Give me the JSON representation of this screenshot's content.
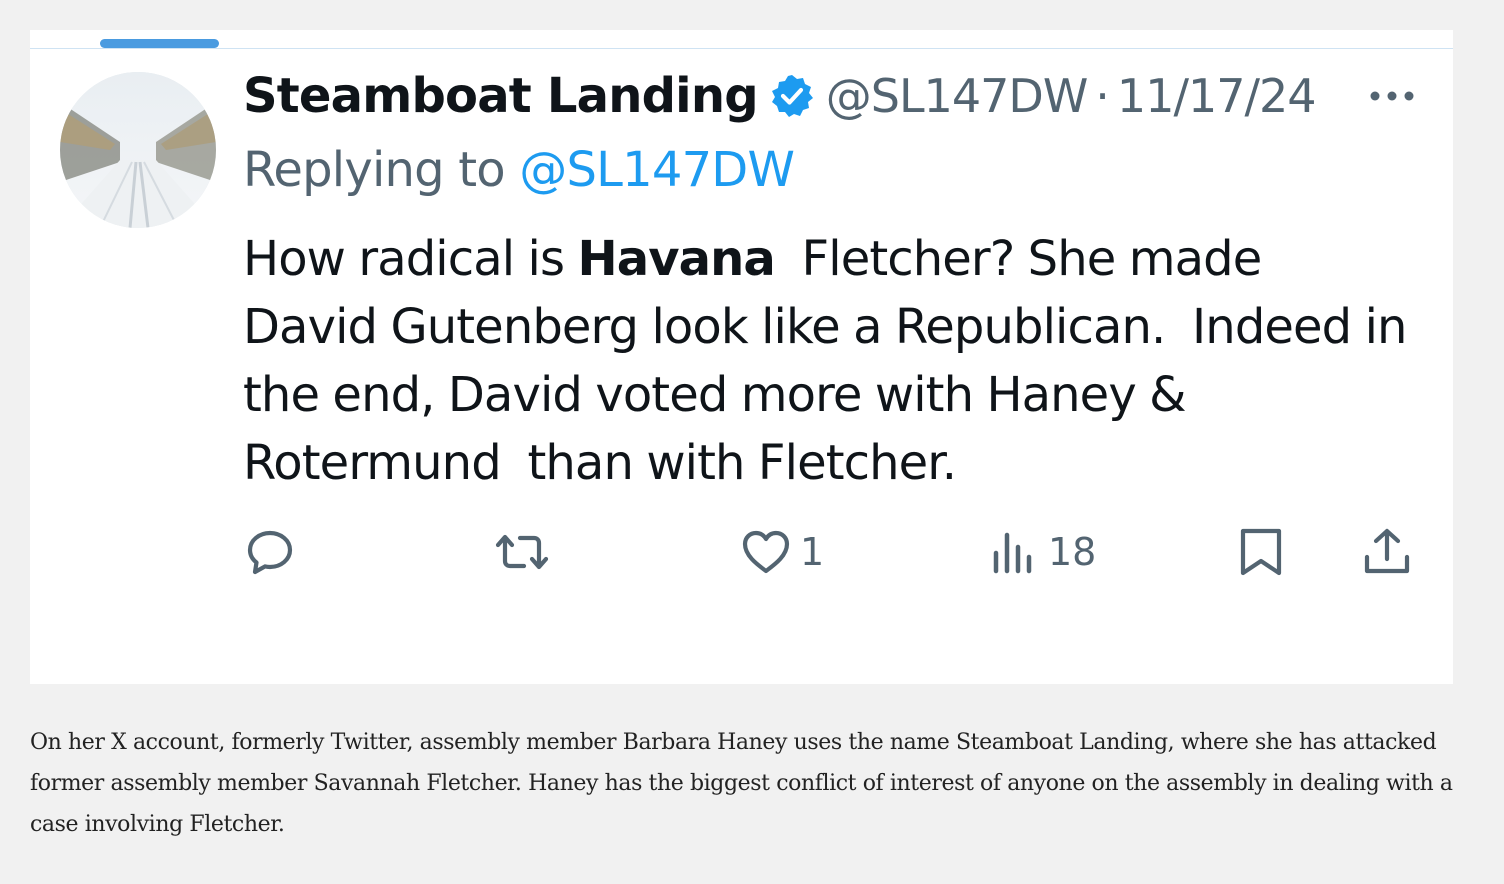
{
  "tweet": {
    "display_name": "Steamboat Landing",
    "handle": "@SL147DW",
    "separator": "·",
    "date": "11/17/24",
    "replying_prefix": "Replying to ",
    "replying_handle": "@SL147DW",
    "body_lines": [
      {
        "pre": "How radical is ",
        "bold": "Havana",
        "post": "  Fletcher? She made"
      },
      {
        "text": "David Gutenberg look like a Republican.  Indeed in"
      },
      {
        "text": "the end, David voted more with Haney &"
      },
      {
        "text": "Rotermund  than with Fletcher."
      }
    ],
    "actions": {
      "reply_icon": "reply-icon",
      "retweet_icon": "retweet-icon",
      "like_icon": "heart-icon",
      "like_count": "1",
      "views_icon": "views-icon",
      "views_count": "18",
      "bookmark_icon": "bookmark-icon",
      "share_icon": "share-icon"
    },
    "colors": {
      "accent": "#1d9bf0",
      "muted": "#536471",
      "text": "#0f1419"
    }
  },
  "caption": "On her X account, formerly Twitter, assembly member Barbara Haney uses the name Steamboat Landing, where she has attacked former assembly member Savannah Fletcher. Haney has the biggest conflict of interest of anyone on the assembly in dealing with a case involving Fletcher."
}
